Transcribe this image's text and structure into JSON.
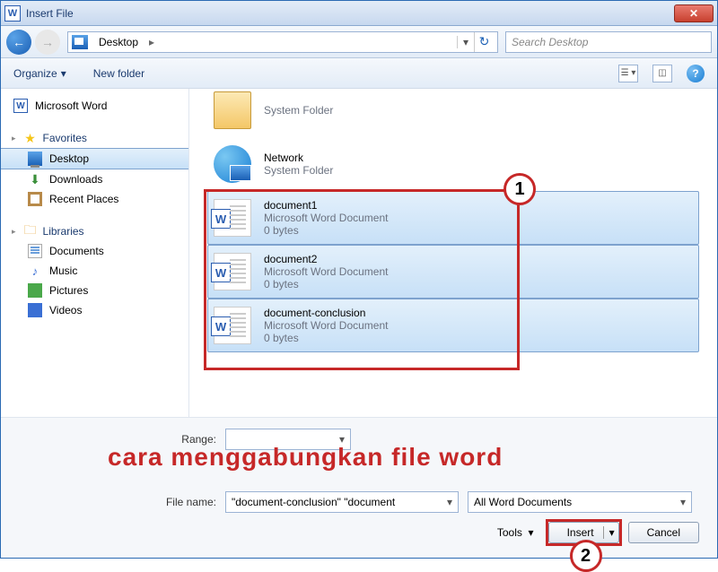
{
  "title": "Insert File",
  "breadcrumb": {
    "location": "Desktop"
  },
  "search": {
    "placeholder": "Search Desktop"
  },
  "toolbar": {
    "organize": "Organize",
    "newfolder": "New folder"
  },
  "sidebar": {
    "word": "Microsoft Word",
    "favorites": "Favorites",
    "fav_items": [
      "Desktop",
      "Downloads",
      "Recent Places"
    ],
    "libraries": "Libraries",
    "lib_items": [
      "Documents",
      "Music",
      "Pictures",
      "Videos"
    ]
  },
  "files": {
    "sysfolder_type": "System Folder",
    "network": "Network",
    "docs": [
      {
        "name": "document1",
        "type": "Microsoft Word Document",
        "size": "0 bytes"
      },
      {
        "name": "document2",
        "type": "Microsoft Word Document",
        "size": "0 bytes"
      },
      {
        "name": "document-conclusion",
        "type": "Microsoft Word Document",
        "size": "0 bytes"
      }
    ]
  },
  "bottom": {
    "range_label": "Range:",
    "filename_label": "File name:",
    "filename_value": "\"document-conclusion\" \"document",
    "filter": "All Word Documents",
    "tools": "Tools",
    "insert": "Insert",
    "cancel": "Cancel"
  },
  "annotations": {
    "overlay": "cara menggabungkan file word",
    "marker1": "1",
    "marker2": "2"
  }
}
